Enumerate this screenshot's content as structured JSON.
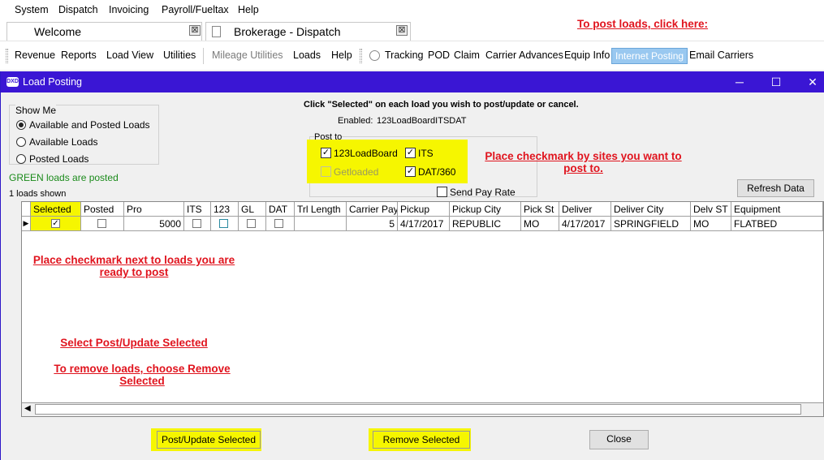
{
  "menu": [
    "System",
    "Dispatch",
    "Invoicing",
    "Payroll/Fueltax",
    "Help"
  ],
  "tabs": [
    {
      "label": "Welcome",
      "close": "⊠"
    },
    {
      "label": "Brokerage - Dispatch",
      "close": "⊠"
    }
  ],
  "post_hint": "To post loads, click here:",
  "toolbar": {
    "revenue": "Revenue",
    "reports": "Reports",
    "load_view": "Load View",
    "utilities": "Utilities",
    "mileage_utilities": "Mileage Utilities",
    "loads": "Loads",
    "help": "Help",
    "tracking": "Tracking",
    "pod": "POD",
    "claim": "Claim",
    "carrier_advances": "Carrier Advances",
    "equip_info": "Equip Info",
    "internet_posting": "Internet Posting",
    "email_carriers": "Email Carriers"
  },
  "dialog": {
    "app_icon": "DXD",
    "title": "Load Posting",
    "minimize": "─",
    "maximize": "☐",
    "close": "✕",
    "show_me": {
      "legend": "Show Me",
      "options": [
        "Available and Posted Loads",
        "Available Loads",
        "Posted Loads"
      ],
      "selected": 0
    },
    "green_note": "GREEN loads are posted",
    "loads_shown": "1 loads shown",
    "instruction": "Click \"Selected\" on each load you wish to post/update or cancel.",
    "enabled_label": "Enabled:",
    "enabled_value": "123LoadBoardITSDAT",
    "post_to": {
      "legend": "Post to",
      "sites": {
        "s123": {
          "label": "123LoadBoard",
          "checked": true
        },
        "its": {
          "label": "ITS",
          "checked": true
        },
        "getloaded": {
          "label": "Getloaded",
          "checked": false,
          "disabled": true
        },
        "dat": {
          "label": "DAT/360",
          "checked": true
        }
      },
      "send_pay_rate": {
        "label": "Send Pay Rate",
        "checked": false
      }
    },
    "site_note": "Place checkmark by  sites you want to post to.",
    "refresh_button": "Refresh Data",
    "grid": {
      "headers": [
        "Selected",
        "Posted",
        "Pro",
        "ITS",
        "123",
        "GL",
        "DAT",
        "Trl Length",
        "Carrier Pay",
        "Pickup",
        "Pickup City",
        "Pick St",
        "Deliver",
        "Deliver City",
        "Delv ST",
        "Equipment"
      ],
      "row": {
        "selected": "✓",
        "pro": "5000",
        "trl_length": "",
        "carrier_pay": "5",
        "pickup": "4/17/2017",
        "pickup_city": "REPUBLIC",
        "pick_st": "MO",
        "deliver": "4/17/2017",
        "deliver_city": "SPRINGFIELD",
        "delv_st": "MO",
        "equipment": "FLATBED"
      }
    },
    "notes": {
      "select_loads": "Place checkmark next to loads you are ready to post",
      "post_selected": "Select Post/Update Selected",
      "remove_loads": "To remove loads, choose Remove Selected"
    },
    "buttons": {
      "post": "Post/Update Selected",
      "remove": "Remove Selected",
      "close": "Close"
    }
  }
}
